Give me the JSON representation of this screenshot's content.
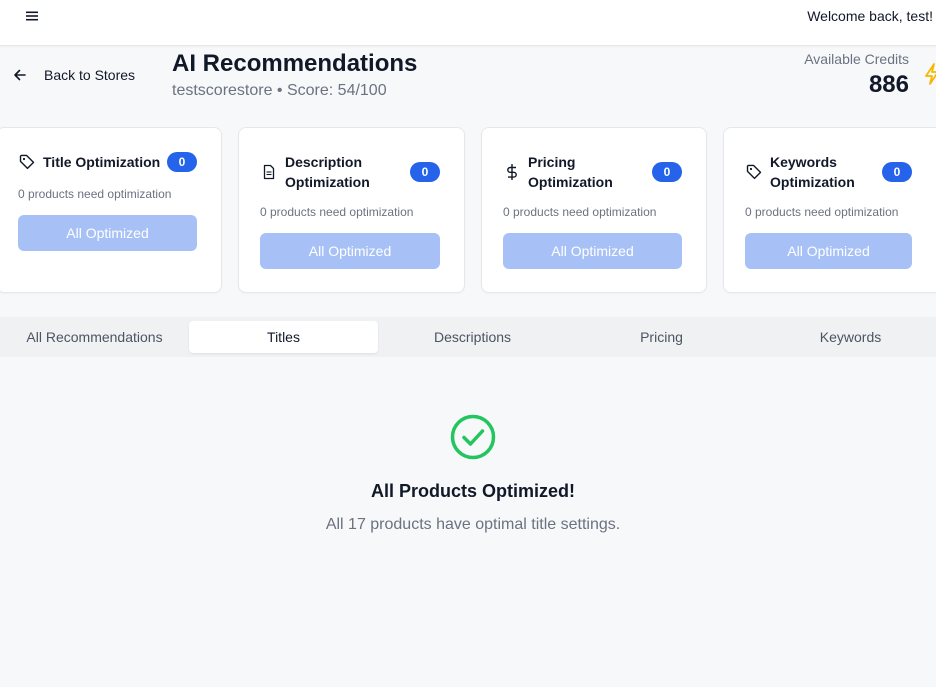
{
  "header": {
    "welcome": "Welcome back, test!"
  },
  "nav": {
    "back_label": "Back to Stores"
  },
  "page": {
    "title": "AI Recommendations",
    "subtitle": "testscorestore • Score: 54/100"
  },
  "credits": {
    "label": "Available Credits",
    "value": "886",
    "icon": "lightning-icon"
  },
  "cards": [
    {
      "title": "Title Optimization",
      "count": "0",
      "description": "0 products need optimization",
      "button": "All Optimized",
      "icon": "tag-icon"
    },
    {
      "title": "Description Optimization",
      "count": "0",
      "description": "0 products need optimization",
      "button": "All Optimized",
      "icon": "document-icon"
    },
    {
      "title": "Pricing Optimization",
      "count": "0",
      "description": "0 products need optimization",
      "button": "All Optimized",
      "icon": "dollar-icon"
    },
    {
      "title": "Keywords Optimization",
      "count": "0",
      "description": "0 products need optimization",
      "button": "All Optimized",
      "icon": "tag-icon"
    }
  ],
  "tabs": [
    {
      "label": "All Recommendations"
    },
    {
      "label": "Titles"
    },
    {
      "label": "Descriptions"
    },
    {
      "label": "Pricing"
    },
    {
      "label": "Keywords"
    }
  ],
  "active_tab": "Titles",
  "empty_state": {
    "title": "All Products Optimized!",
    "message": "All 17 products have optimal title settings.",
    "icon": "check-circle-icon"
  },
  "colors": {
    "accent": "#2563eb",
    "disabled_button": "#a7c1f7",
    "success": "#22c55e",
    "credit_icon": "#f5b800"
  }
}
